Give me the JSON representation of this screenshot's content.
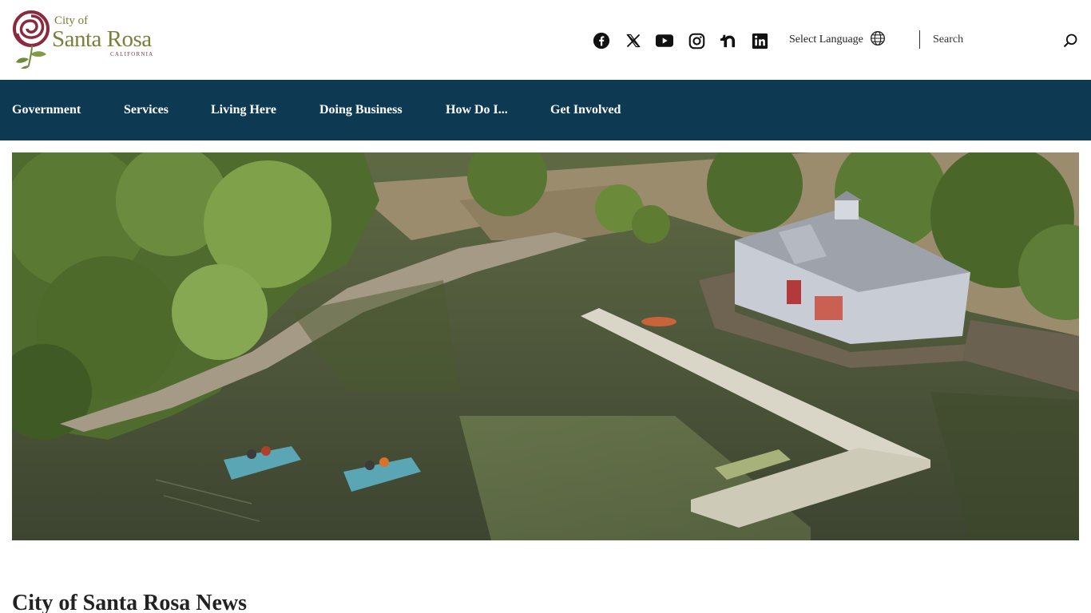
{
  "logo": {
    "city_of": "City of",
    "name": "Santa Rosa",
    "state": "CALIFORNIA"
  },
  "social": [
    {
      "name": "facebook-icon"
    },
    {
      "name": "x-icon"
    },
    {
      "name": "youtube-icon"
    },
    {
      "name": "instagram-icon"
    },
    {
      "name": "nextdoor-icon"
    },
    {
      "name": "linkedin-icon"
    }
  ],
  "language": {
    "label": "Select Language",
    "icon": "globe-icon"
  },
  "search": {
    "placeholder": "Search",
    "icon": "search-icon"
  },
  "nav": {
    "items": [
      {
        "label": "Government"
      },
      {
        "label": "Services"
      },
      {
        "label": "Living Here"
      },
      {
        "label": "Doing Business"
      },
      {
        "label": "How Do I..."
      },
      {
        "label": "Get Involved"
      }
    ]
  },
  "colors": {
    "nav_bg": "#0d3a52",
    "logo_rose": "#8a2a3e",
    "logo_text": "#7a7f3a",
    "leaf": "#6b8a3a"
  },
  "news": {
    "title": "City of Santa Rosa News"
  }
}
